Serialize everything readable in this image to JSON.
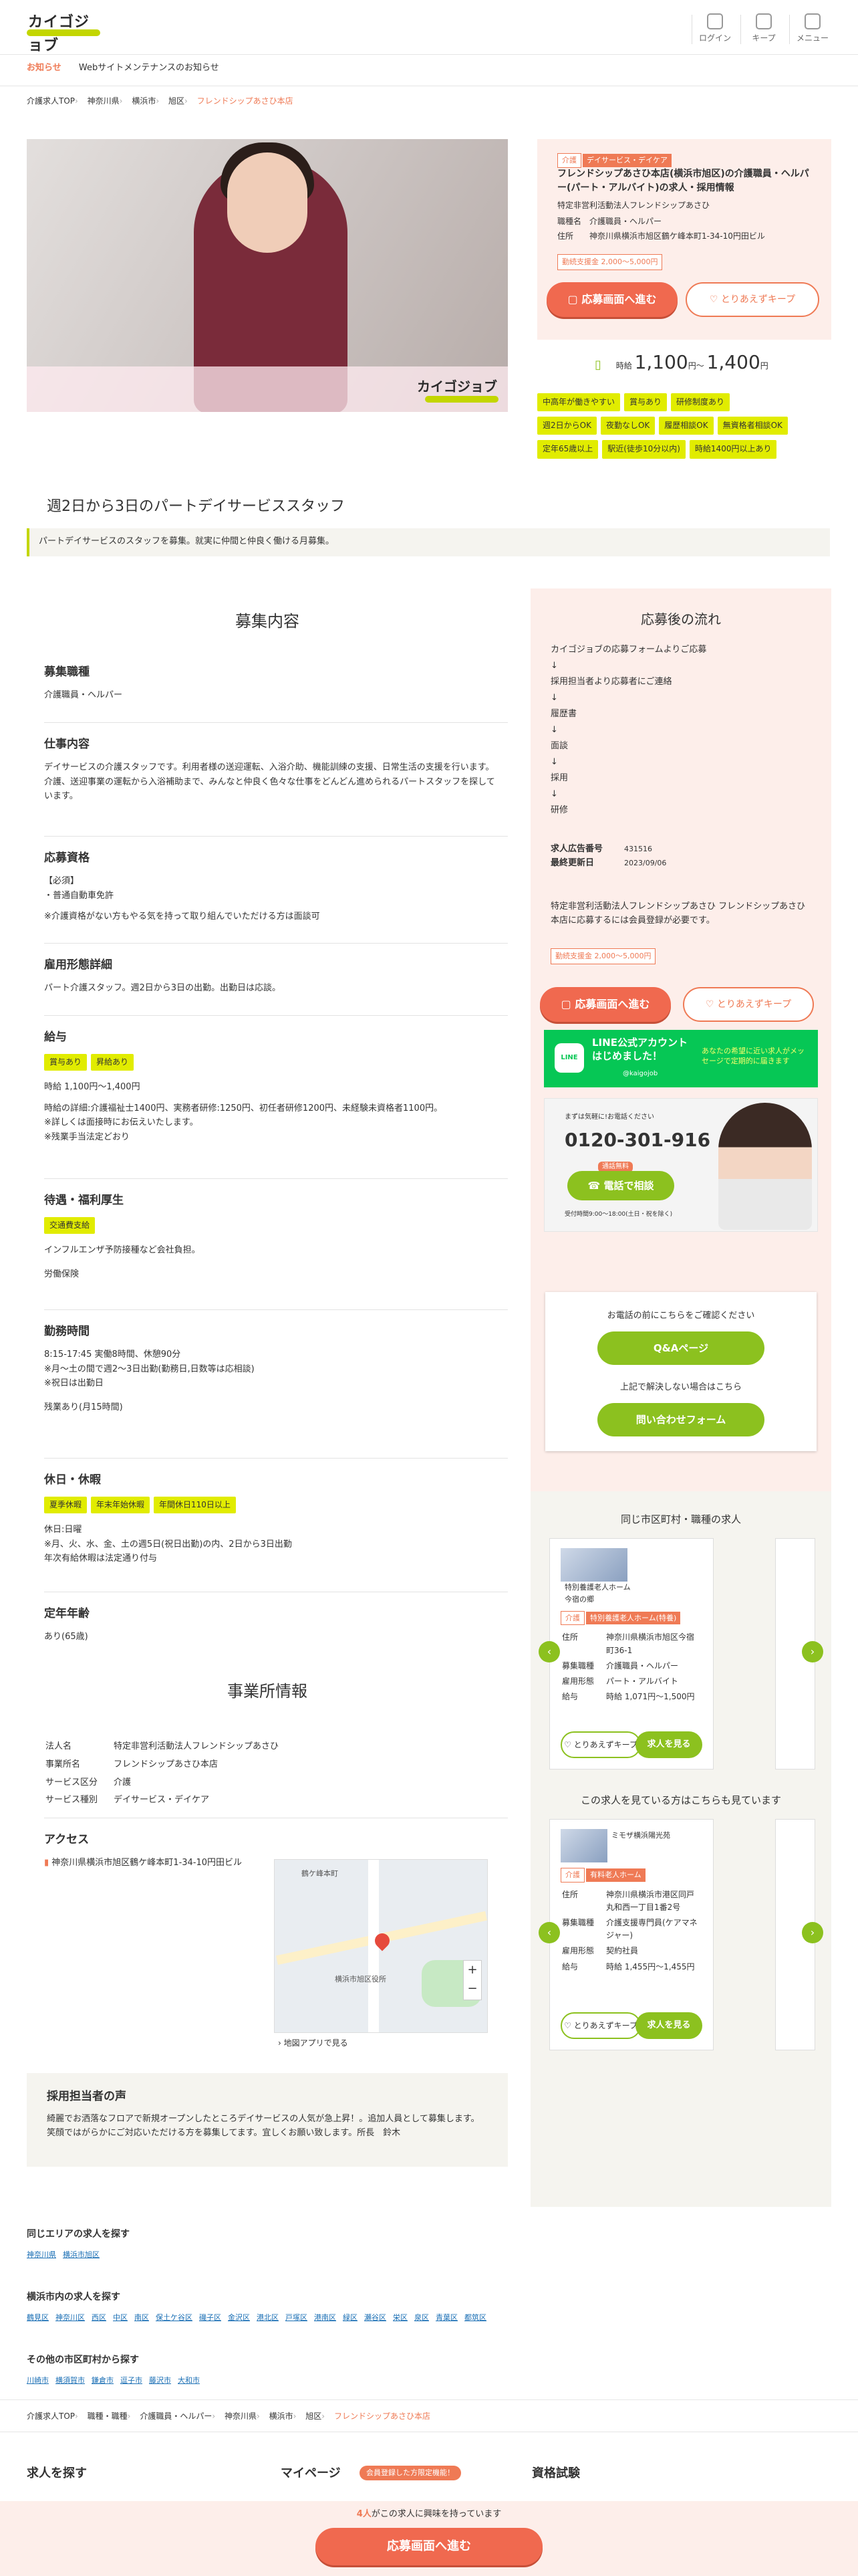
{
  "header": {
    "logo": "カイゴジョブ",
    "login": "ログイン",
    "keep": "キープ",
    "menu": "メニュー"
  },
  "notice": {
    "label": "お知らせ",
    "text": "Webサイトメンテナンスのお知らせ"
  },
  "breadcrumb": [
    "介護求人TOP",
    "神奈川県",
    "横浜市",
    "旭区",
    "フレンドシップあさひ本店"
  ],
  "job": {
    "tag1": "介護",
    "tag2": "デイサービス・デイケア",
    "title": "フレンドシップあさひ本店(横浜市旭区)の介護職員・ヘルパー(パート・アルバイト)の求人・採用情報",
    "corp": "特定非営利活動法人フレンドシップあさひ",
    "job_type_k": "職種名",
    "job_type_v": "介護職員・ヘルパー",
    "addr_k": "住所",
    "addr_v": "神奈川県横浜市旭区鶴ケ峰本町1-34-10円田ビル",
    "bonus": "勤続支援金 2,000〜5,000円",
    "apply": "応募画面へ進む",
    "keep": "とりあえずキープ",
    "wage_prefix": "時給",
    "wage_from": "1,100",
    "wage_mid": "円〜",
    "wage_to": "1,400",
    "wage_suffix": "円",
    "tags": [
      "中高年が働きやすい",
      "賞与あり",
      "研修制度あり",
      "週2日からOK",
      "夜勤なしOK",
      "履歴相談OK",
      "無資格者相談OK",
      "定年65歳以上",
      "駅近(徒歩10分以内)",
      "時給1400円以上あり"
    ]
  },
  "catch": {
    "title": "週2日から3日のパートデイサービススタッフ",
    "lead": "パートデイサービスのスタッフを募集。就実に仲間と仲良く働ける月募集。"
  },
  "recruit": {
    "heading": "募集内容",
    "s1_h": "募集職種",
    "s1_p": "介護職員・ヘルパー",
    "s2_h": "仕事内容",
    "s2_p1": "デイサービスの介護スタッフです。利用者様の送迎運転、入浴介助、機能訓練の支援、日常生活の支援を行います。",
    "s2_p2": "介護、送迎事業の運転から入浴補助まで、みんなと仲良く色々な仕事をどんどん進められるパートスタッフを探しています。",
    "s3_h": "応募資格",
    "s3_p1": "【必須】",
    "s3_p2": "・普通自動車免許",
    "s3_p3": "※介護資格がない方もやる気を持って取り組んでいただける方は面談可",
    "s4_h": "雇用形態詳細",
    "s4_p": "パート介護スタッフ。週2日から3日の出勤。出勤日は応談。",
    "s5_h": "給与",
    "s5_t1": "賞与あり",
    "s5_t2": "昇給あり",
    "s5_p1": "時給 1,100円〜1,400円",
    "s5_p2": "時給の詳細:介護福祉士1400円、実務者研修:1250円、初任者研修1200円、未経験未資格者1100円。",
    "s5_p3": "※詳しくは面接時にお伝えいたします。",
    "s5_p4": "※残業手当法定どおり",
    "s6_h": "待遇・福利厚生",
    "s6_t1": "交通費支給",
    "s6_p1": "インフルエンザ予防接種など会社負担。",
    "s6_p2": "労働保険",
    "s7_h": "勤務時間",
    "s7_p1": "8:15-17:45 実働8時間、休憩90分",
    "s7_p2": "※月〜土の間で週2〜3日出勤(勤務日,日数等は応相談)",
    "s7_p3": "※祝日は出勤日",
    "s7_p4": "残業あり(月15時間)",
    "s8_h": "休日・休暇",
    "s8_t1": "夏季休暇",
    "s8_t2": "年末年始休暇",
    "s8_t3": "年間休日110日以上",
    "s8_p1": "休日:日曜",
    "s8_p2": "※月、火、水、金、土の週5日(祝日出勤)の内、2日から3日出勤",
    "s8_p3": "年次有給休暇は法定通り付与",
    "s9_h": "定年年齢",
    "s9_p": "あり(65歳)"
  },
  "office": {
    "heading": "事業所情報",
    "rows": [
      {
        "k": "法人名",
        "v": "特定非営利活動法人フレンドシップあさひ"
      },
      {
        "k": "事業所名",
        "v": "フレンドシップあさひ本店"
      },
      {
        "k": "サービス区分",
        "v": "介護"
      },
      {
        "k": "サービス種別",
        "v": "デイサービス・デイケア"
      }
    ],
    "access_h": "アクセス",
    "access_addr": "神奈川県横浜市旭区鶴ケ峰本町1-34-10円田ビル",
    "map_station": "鶴ケ峰本町",
    "map_label2": "横浜市旭区役所",
    "map_link": "地図アプリで見る"
  },
  "voice": {
    "heading": "採用担当者の声",
    "p1": "綺麗でお洒落なフロアで新規オープンしたところデイサービスの人気が急上昇！。追加人員として募集します。",
    "p2": "笑顔ではがらかにご対応いただける方を募集してます。宜しくお願い致します。所長　鈴木"
  },
  "flow": {
    "heading": "応募後の流れ",
    "steps": [
      "カイゴジョブの応募フォームよりご応募",
      "↓",
      "採用担当者より応募者にご連絡",
      "↓",
      "履歴書",
      "↓",
      "面談",
      "↓",
      "採用",
      "↓",
      "研修"
    ],
    "adnum_k": "求人広告番号",
    "adnum_v": "431516",
    "upd_k": "最終更新日",
    "upd_v": "2023/09/06",
    "note": "特定非営利活動法人フレンドシップあさひ フレンドシップあさひ本店に応募するには会員登録が必要です。"
  },
  "line": {
    "title": "LINE公式アカウントはじめました！",
    "sub": "あなたの希望に近い求人がメッセージで定期的に届きます",
    "id": "@kaigojob"
  },
  "tel": {
    "pre": "まずは気軽に!お電話ください",
    "num": "0120-301-916",
    "btn": "電話で相談",
    "badge": "通話無料",
    "hours": "受付時間9:00〜18:00(土日・祝を除く)"
  },
  "qa": {
    "lead": "お電話の前にこちらをご確認ください",
    "btn1": "Q&Aページ",
    "lead2": "上記で解決しない場合はこちら",
    "btn2": "問い合わせフォーム"
  },
  "similar": {
    "heading": "同じ市区町村・職種の求人",
    "card": {
      "name": "特別養護老人ホーム　今宿の郷",
      "tag1": "介護",
      "tag2": "特別養護老人ホーム(特養)",
      "k1": "住所",
      "v1": "神奈川県横浜市旭区今宿町36-1",
      "k2": "募集職種",
      "v2": "介護職員・ヘルパー",
      "k3": "雇用形態",
      "v3": "パート・アルバイト",
      "k4": "給与",
      "v4": "時給 1,071円〜1,500円",
      "keep": "とりあえずキープ",
      "see": "求人を見る"
    }
  },
  "viewed": {
    "heading": "この求人を見ている方はこちらも見ています",
    "card": {
      "name": "ミモザ横浜陽光苑",
      "tag1": "介護",
      "tag2": "有料老人ホーム",
      "k1": "住所",
      "v1": "神奈川県横浜市港区同戸丸和西一丁目1番2号",
      "k2": "募集職種",
      "v2": "介護支援専門員(ケアマネジャー)",
      "k3": "雇用形態",
      "v3": "契約社員",
      "k4": "給与",
      "v4": "時給 1,455円〜1,455円",
      "keep": "とりあえずキープ",
      "see": "求人を見る"
    }
  },
  "links": {
    "area_h": "同じエリアの求人を探す",
    "area": [
      "神奈川県",
      "横浜市旭区"
    ],
    "city_h": "横浜市内の求人を探す",
    "city": [
      "鶴見区",
      "神奈川区",
      "西区",
      "中区",
      "南区",
      "保土ケ谷区",
      "磯子区",
      "金沢区",
      "港北区",
      "戸塚区",
      "港南区",
      "緑区",
      "瀬谷区",
      "栄区",
      "泉区",
      "青葉区",
      "都筑区"
    ],
    "other_h": "その他の市区町村から探す",
    "other": [
      "川崎市",
      "横須賀市",
      "鎌倉市",
      "逗子市",
      "藤沢市",
      "大和市"
    ]
  },
  "bottomcrumb": [
    "介護求人TOP",
    "職種・職種",
    "介護職員・ヘルパー",
    "神奈川県",
    "横浜市",
    "旭区",
    "フレンドシップあさひ本店"
  ],
  "footer": {
    "c1": "求人を探す",
    "c2": "マイページ",
    "c2badge": "会員登録した方限定機能！",
    "c3": "資格試験"
  },
  "sticky": {
    "count": "4人",
    "text": "がこの求人に興味を持っています",
    "btn": "応募画面へ進む"
  }
}
